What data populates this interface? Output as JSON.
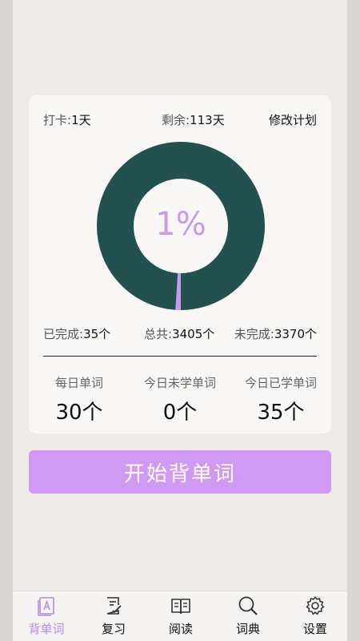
{
  "plan": {
    "checkin_label": "打卡:",
    "checkin_value": "1天",
    "remaining_label": "剩余:",
    "remaining_value": "113天",
    "edit_plan": "修改计划"
  },
  "progress": {
    "percent_text": "1%",
    "fraction": 0.0103,
    "ring_color": "#225150",
    "fill_color": "#c79bec"
  },
  "stats": {
    "done_label": "已完成:",
    "done_value": "35个",
    "total_label": "总共:",
    "total_value": "3405个",
    "undone_label": "未完成:",
    "undone_value": "3370个"
  },
  "daily": [
    {
      "label": "每日单词",
      "value": "30个"
    },
    {
      "label": "今日未学单词",
      "value": "0个"
    },
    {
      "label": "今日已学单词",
      "value": "35个"
    }
  ],
  "start_button": "开始背单词",
  "colors": {
    "accent": "#cf99f4",
    "active_tab": "#b98be6"
  },
  "tabs": [
    {
      "label": "背单词",
      "icon": "flashcard-icon",
      "active": true
    },
    {
      "label": "复习",
      "icon": "review-icon",
      "active": false
    },
    {
      "label": "阅读",
      "icon": "book-icon",
      "active": false
    },
    {
      "label": "词典",
      "icon": "search-icon",
      "active": false
    },
    {
      "label": "设置",
      "icon": "gear-icon",
      "active": false
    }
  ]
}
